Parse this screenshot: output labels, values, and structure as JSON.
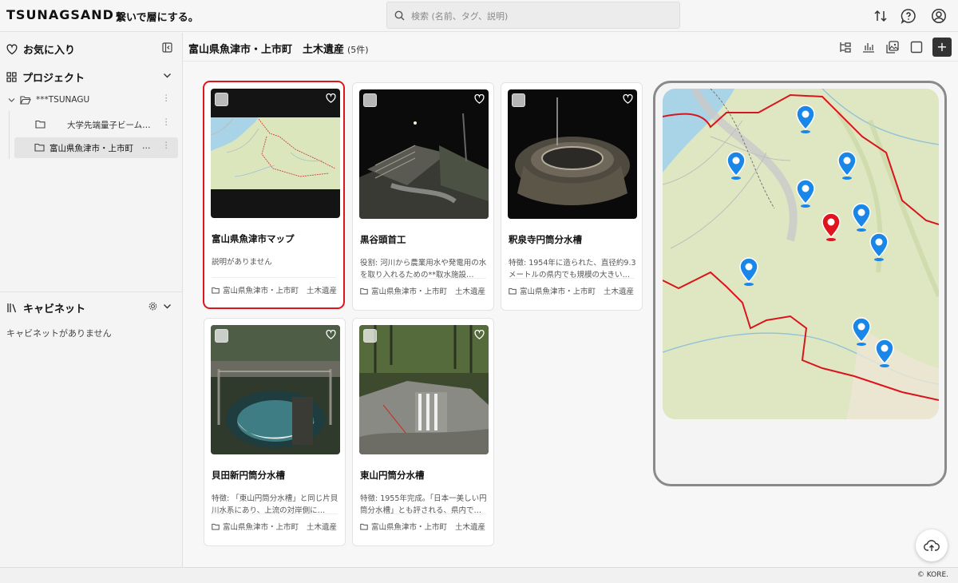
{
  "app": {
    "logo": "TSUNAGSAND",
    "tagline": "繋いで層にする。"
  },
  "search": {
    "placeholder": "検索 (名前、タグ、説明)"
  },
  "sidebar": {
    "favorites_label": "お気に入り",
    "projects_label": "プロジェクト",
    "tree": [
      {
        "label": "***TSUNAGU"
      },
      {
        "label": "大学先端量子ビーム…"
      },
      {
        "label": "富山県魚津市・上市町",
        "more": "…"
      }
    ],
    "cabinet_label": "キャビネット",
    "cabinet_empty": "キャビネットがありません"
  },
  "main": {
    "title": "富山県魚津市・上市町　土木遺産",
    "count": "(5件)",
    "add_label": "+"
  },
  "cards": [
    {
      "title": "富山県魚津市マップ",
      "desc": "説明がありません",
      "folder": "富山県魚津市・上市町",
      "tag": "土木遺産"
    },
    {
      "title": "黒谷頭首工",
      "desc": "役割: 河川から農業用水や発電用の水を取り入れるための**取水施設…",
      "folder": "富山県魚津市・上市町",
      "tag": "土木遺産"
    },
    {
      "title": "釈泉寺円筒分水槽",
      "desc": "特徴: 1954年に造られた、直径約9.3メートルの県内でも規模の大きい…",
      "folder": "富山県魚津市・上市町",
      "tag": "土木遺産"
    },
    {
      "title": "貝田新円筒分水槽",
      "desc": "特徴: 「東山円筒分水槽」と同じ片貝川水系にあり、上流の対岸側に…",
      "folder": "富山県魚津市・上市町",
      "tag": "土木遺産"
    },
    {
      "title": "東山円筒分水槽",
      "desc": "特徴: 1955年完成。「日本一美しい円筒分水槽」とも評される、県内で…",
      "folder": "富山県魚津市・上市町",
      "tag": "土木遺産"
    }
  ],
  "footer": {
    "copyright": "© KORE."
  },
  "colors": {
    "highlight": "#e0141e",
    "pin_blue": "#1a86e8",
    "pin_red": "#e0141e",
    "map_land": "#dfe7c2",
    "map_water": "#a9d3e6"
  }
}
